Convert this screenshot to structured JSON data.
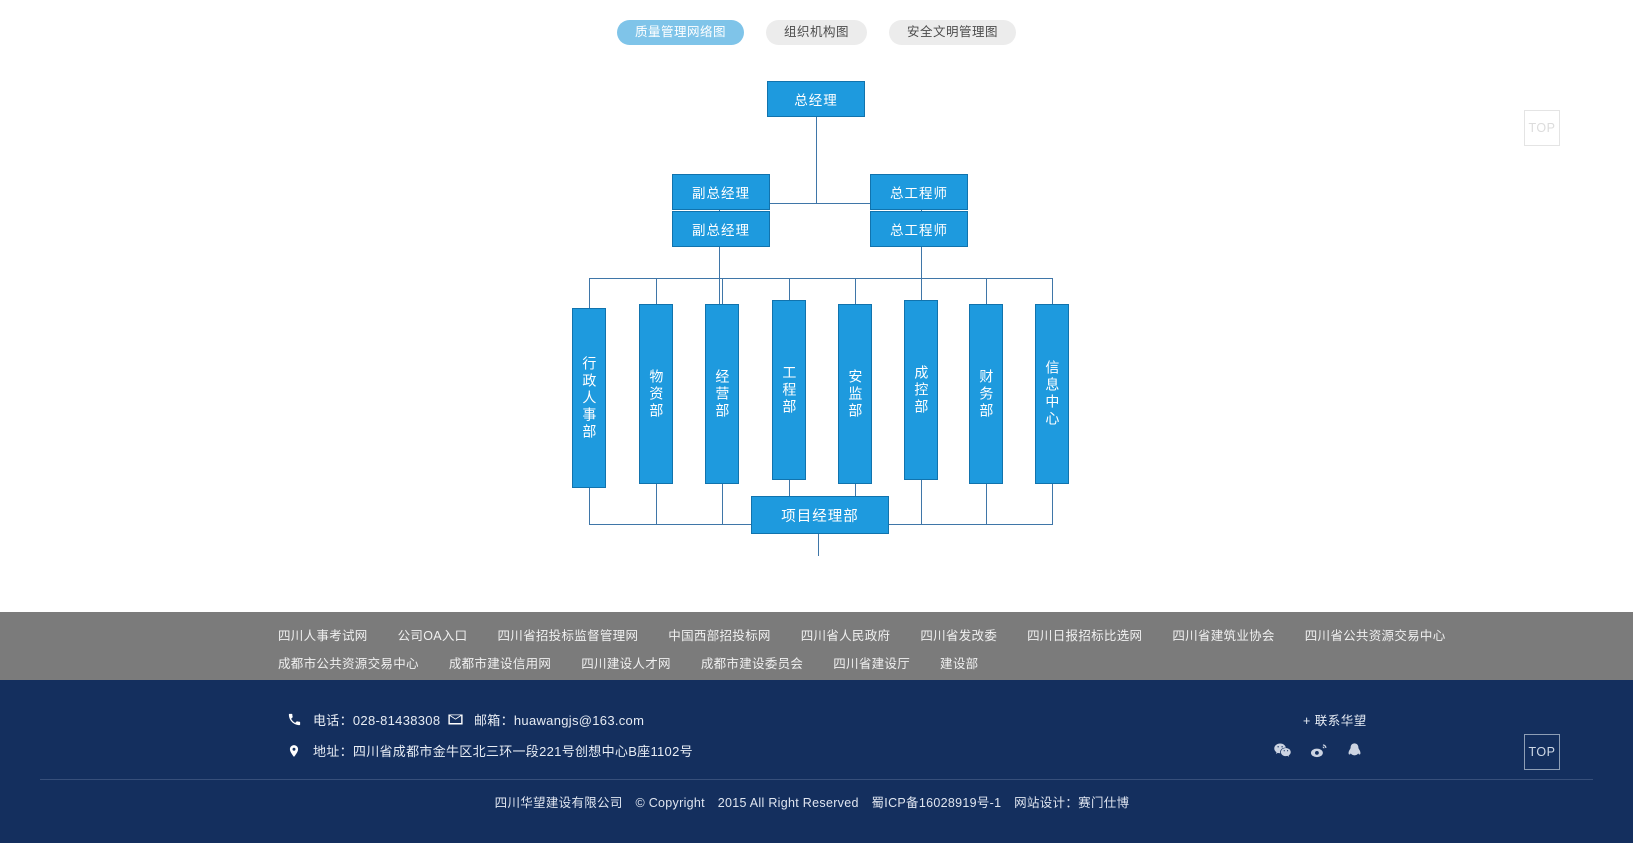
{
  "tabs": [
    {
      "label": "质量管理网络图",
      "active": true
    },
    {
      "label": "组织机构图",
      "active": false
    },
    {
      "label": "安全文明管理图",
      "active": false
    }
  ],
  "colors": {
    "node_fill": "#1e9ade",
    "node_border": "#1173ad",
    "connector": "#3f76a8",
    "tab_active": "#7fc4e9",
    "tab_inactive": "#ececec",
    "footer_links_band": "#7b7b7b",
    "footer_contact_band": "#142f5e"
  },
  "chart_data": {
    "type": "diagram",
    "title": "组织机构图",
    "orientation": "top-down",
    "nodes": {
      "root": "总经理",
      "level2": [
        "副总经理",
        "总工程师"
      ],
      "level3": [
        "副总经理",
        "总工程师"
      ],
      "departments": [
        "行政人事部",
        "物资部",
        "经营部",
        "工程部",
        "安监部",
        "成控部",
        "财务部",
        "信息中心"
      ],
      "bottom": "项目经理部"
    }
  },
  "top_button": {
    "label": "TOP"
  },
  "footer": {
    "links_row_1": [
      "四川人事考试网",
      "公司OA入口",
      "四川省招投标监督管理网",
      "中国西部招投标网",
      "四川省人民政府",
      "四川省发改委",
      "四川日报招标比选网",
      "四川省建筑业协会",
      "四川省公共资源交易中心"
    ],
    "links_row_2": [
      "成都市公共资源交易中心",
      "成都市建设信用网",
      "四川建设人才网",
      "成都市建设委员会",
      "四川省建设厅",
      "建设部"
    ],
    "contact": {
      "phone": "电话：028-81438308",
      "email": "邮箱：huawangjs@163.com",
      "address": "地址：四川省成都市金牛区北三环一段221号创想中心B座1102号",
      "join_label": "+ 联系华望"
    },
    "socials": [
      {
        "name": "wechat-icon"
      },
      {
        "name": "weibo-icon"
      },
      {
        "name": "qq-icon"
      }
    ],
    "copyright": {
      "company": "四川华望建设有限公司",
      "copy": "© Copyright",
      "rights": "2015 All Right Reserved",
      "icp": "蜀ICP备16028919号-1",
      "designer": "网站设计：赛门仕博"
    }
  }
}
